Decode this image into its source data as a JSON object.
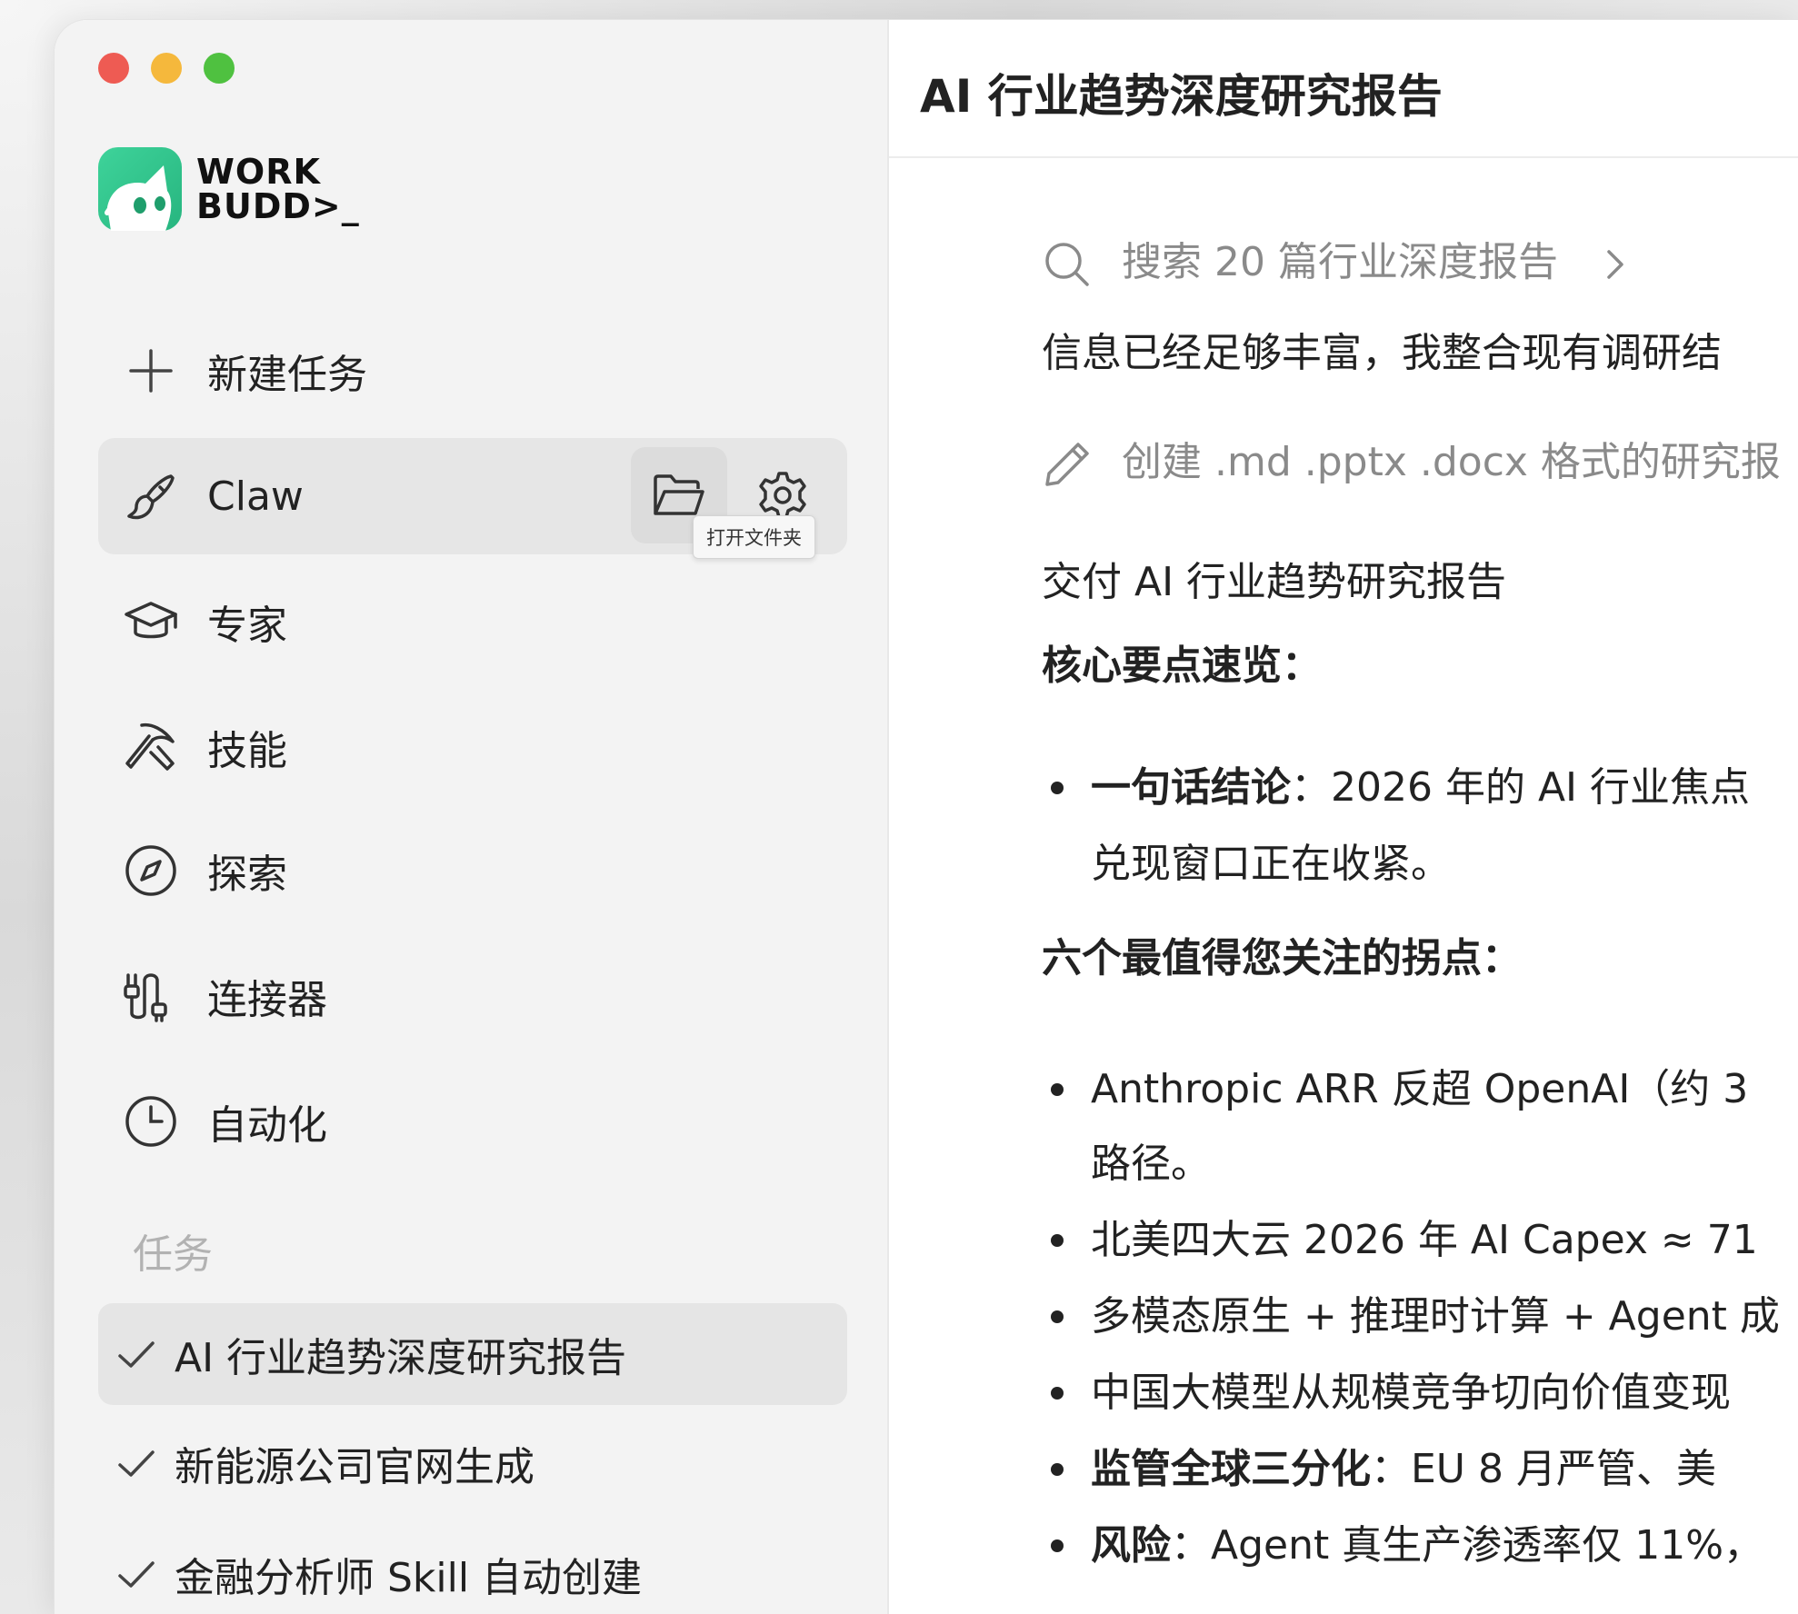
{
  "app": {
    "logo_line1": "WORK",
    "logo_line2": "BUDD>_"
  },
  "sidebar": {
    "new_task": "新建任务",
    "nav": [
      {
        "label": "Claw",
        "icon": "brush-icon"
      },
      {
        "label": "专家",
        "icon": "graduation-cap-icon"
      },
      {
        "label": "技能",
        "icon": "tools-icon"
      },
      {
        "label": "探索",
        "icon": "compass-icon"
      },
      {
        "label": "连接器",
        "icon": "plug-icon"
      },
      {
        "label": "自动化",
        "icon": "clock-icon"
      }
    ],
    "claw_tooltip": "打开文件夹",
    "section_title": "任务",
    "tasks": [
      {
        "label": "AI 行业趋势深度研究报告"
      },
      {
        "label": "新能源公司官网生成"
      },
      {
        "label": "金融分析师 Skill 自动创建"
      }
    ]
  },
  "main": {
    "title": "AI 行业趋势深度研究报告",
    "search_step": "搜索 20 篇行业深度报告",
    "intro": "信息已经足够丰富，我整合现有调研结",
    "create_step": "创建 .md .pptx .docx 格式的研究报",
    "deliver": "交付 AI 行业趋势研究报告",
    "core_heading": "核心要点速览：",
    "conclusion_label": "一句话结论",
    "conclusion_text": "：2026 年的 AI 行业焦点",
    "conclusion_text2": "兑现窗口正在收紧。",
    "six_heading": "六个最值得您关注的拐点：",
    "points": [
      {
        "label": "",
        "text": "Anthropic ARR 反超 OpenAI（约 3",
        "text2": "路径。"
      },
      {
        "label": "",
        "text": "北美四大云 2026 年 AI Capex ≈ 71"
      },
      {
        "label": "",
        "text": "多模态原生 + 推理时计算 + Agent 成"
      },
      {
        "label": "",
        "text": "中国大模型从规模竞争切向价值变现"
      },
      {
        "label": "监管全球三分化",
        "text": "：EU 8 月严管、美"
      },
      {
        "label": "风险",
        "text": "：Agent 真生产渗透率仅 11%，"
      }
    ]
  }
}
